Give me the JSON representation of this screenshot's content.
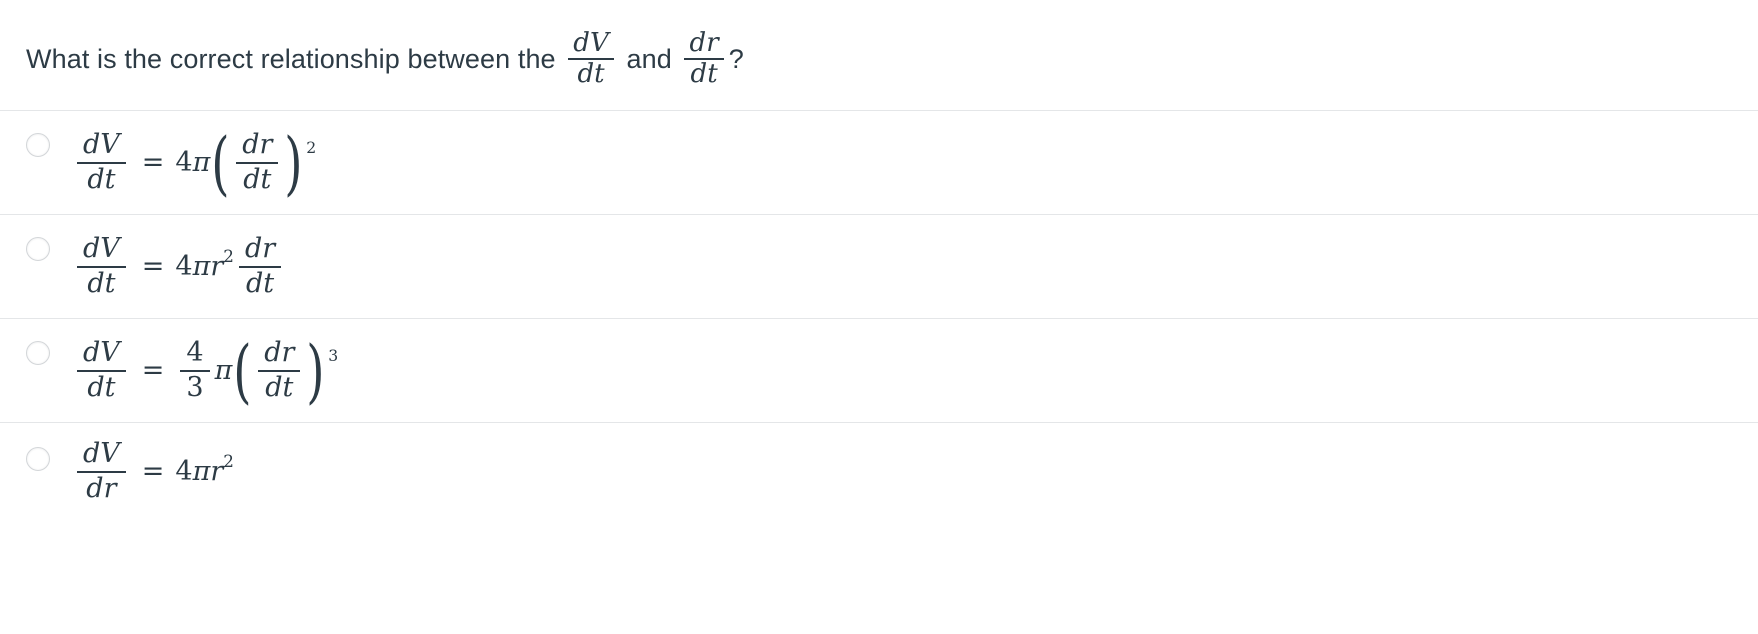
{
  "question": {
    "prefix": "What is the correct relationship between the ",
    "frac1": {
      "num": "dV",
      "den": "dt"
    },
    "middle": " and ",
    "frac2": {
      "num": "dr",
      "den": "dt"
    },
    "suffix": "?"
  },
  "answers": [
    {
      "id": "answer-option-1",
      "selected": false,
      "latex": "dV/dt = 4π (dr/dt)^2",
      "lhs": {
        "num": "dV",
        "den": "dt"
      },
      "equals": "=",
      "coefficient": "4",
      "pi": "π",
      "paren_open": "(",
      "inner": {
        "num": "dr",
        "den": "dt"
      },
      "paren_close": ")",
      "exponent": "2"
    },
    {
      "id": "answer-option-2",
      "selected": false,
      "latex": "dV/dt = 4πr^2 dr/dt",
      "lhs": {
        "num": "dV",
        "den": "dt"
      },
      "equals": "=",
      "coefficient": "4",
      "pi": "π",
      "variable": "r",
      "var_exponent": "2",
      "rhs": {
        "num": "dr",
        "den": "dt"
      }
    },
    {
      "id": "answer-option-3",
      "selected": false,
      "latex": "dV/dt = (4/3)π (dr/dt)^3",
      "lhs": {
        "num": "dV",
        "den": "dt"
      },
      "equals": "=",
      "coefficient_frac": {
        "num": "4",
        "den": "3"
      },
      "pi": "π",
      "paren_open": "(",
      "inner": {
        "num": "dr",
        "den": "dt"
      },
      "paren_close": ")",
      "exponent": "3"
    },
    {
      "id": "answer-option-4",
      "selected": false,
      "latex": "dV/dr = 4πr^2",
      "lhs": {
        "num": "dV",
        "den": "dr"
      },
      "equals": "=",
      "coefficient": "4",
      "pi": "π",
      "variable": "r",
      "var_exponent": "2"
    }
  ],
  "colors": {
    "text": "#2D3B45",
    "divider": "#e4e6e8",
    "background": "#ffffff",
    "radio_border": "#d3d6d9"
  }
}
